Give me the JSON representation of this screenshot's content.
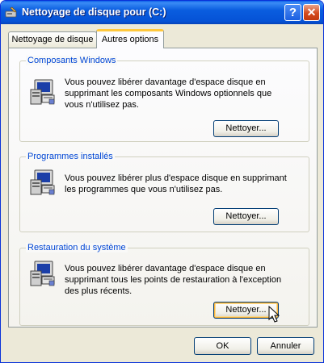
{
  "window": {
    "title": "Nettoyage de disque pour  (C:)",
    "help_symbol": "?",
    "close_symbol": "✕"
  },
  "tabs": [
    {
      "label": "Nettoyage de disque",
      "active": false
    },
    {
      "label": "Autres options",
      "active": true
    }
  ],
  "groups": [
    {
      "title": "Composants Windows",
      "description": "Vous pouvez libérer davantage d'espace disque en supprimant les composants Windows optionnels que vous n'utilisez pas.",
      "button": "Nettoyer...",
      "icon": "computer-icon"
    },
    {
      "title": "Programmes installés",
      "description": "Vous pouvez libérer plus d'espace disque en supprimant les programmes que vous n'utilisez pas.",
      "button": "Nettoyer...",
      "icon": "computer-icon"
    },
    {
      "title": "Restauration du système",
      "description": "Vous pouvez libérer davantage d'espace disque en supprimant tous les points de restauration à l'exception des plus récents.",
      "button": "Nettoyer...",
      "icon": "computer-icon"
    }
  ],
  "footer": {
    "ok_label": "OK",
    "cancel_label": "Annuler"
  },
  "colors": {
    "titlebar": "#0a5ddf",
    "group_title": "#0046d5",
    "active_tab_accent": "#ffc83c",
    "window_bg": "#ece9d8"
  }
}
